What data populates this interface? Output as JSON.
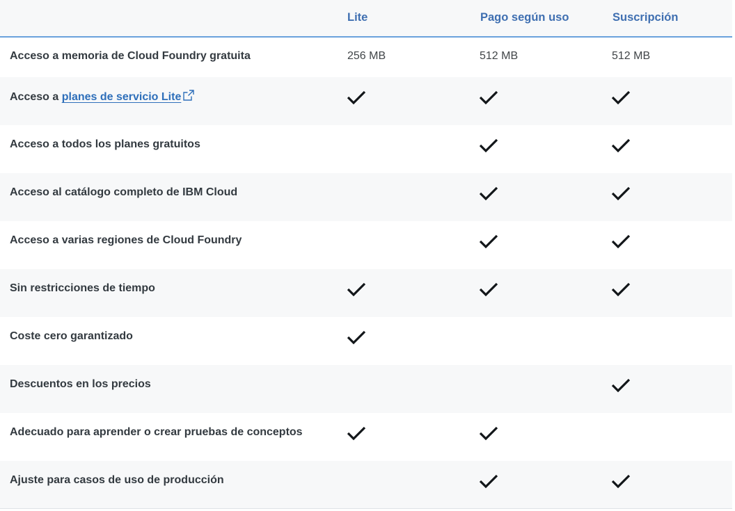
{
  "columns": {
    "lite": "Lite",
    "pago": "Pago según uso",
    "suscripcion": "Suscripción"
  },
  "rows": [
    {
      "label": "Acceso a memoria de Cloud Foundry gratuita",
      "lite": "256 MB",
      "pago": "512 MB",
      "suscripcion": "512 MB"
    },
    {
      "label_prefix": "Acceso a ",
      "link": "planes de servicio Lite",
      "lite": true,
      "pago": true,
      "suscripcion": true
    },
    {
      "label": "Acceso a todos los planes gratuitos",
      "lite": false,
      "pago": true,
      "suscripcion": true
    },
    {
      "label": "Acceso al catálogo completo de IBM Cloud",
      "lite": false,
      "pago": true,
      "suscripcion": true
    },
    {
      "label": "Acceso a varias regiones de Cloud Foundry",
      "lite": false,
      "pago": true,
      "suscripcion": true
    },
    {
      "label": "Sin restricciones de tiempo",
      "lite": true,
      "pago": true,
      "suscripcion": true
    },
    {
      "label": "Coste cero garantizado",
      "lite": true,
      "pago": false,
      "suscripcion": false
    },
    {
      "label": "Descuentos en los precios",
      "lite": false,
      "pago": false,
      "suscripcion": true
    },
    {
      "label": "Adecuado para aprender o crear pruebas de conceptos",
      "lite": true,
      "pago": true,
      "suscripcion": false
    },
    {
      "label": "Ajuste para casos de uso de producción",
      "lite": false,
      "pago": true,
      "suscripcion": true
    }
  ],
  "icons": {
    "check": "checkmark-icon",
    "external": "external-link-icon"
  },
  "colors": {
    "header_text": "#3f6fb1",
    "link": "#2e6fba",
    "header_border": "#6aa1dc",
    "row_alt_bg": "#f7f8f9",
    "check": "#121619"
  }
}
